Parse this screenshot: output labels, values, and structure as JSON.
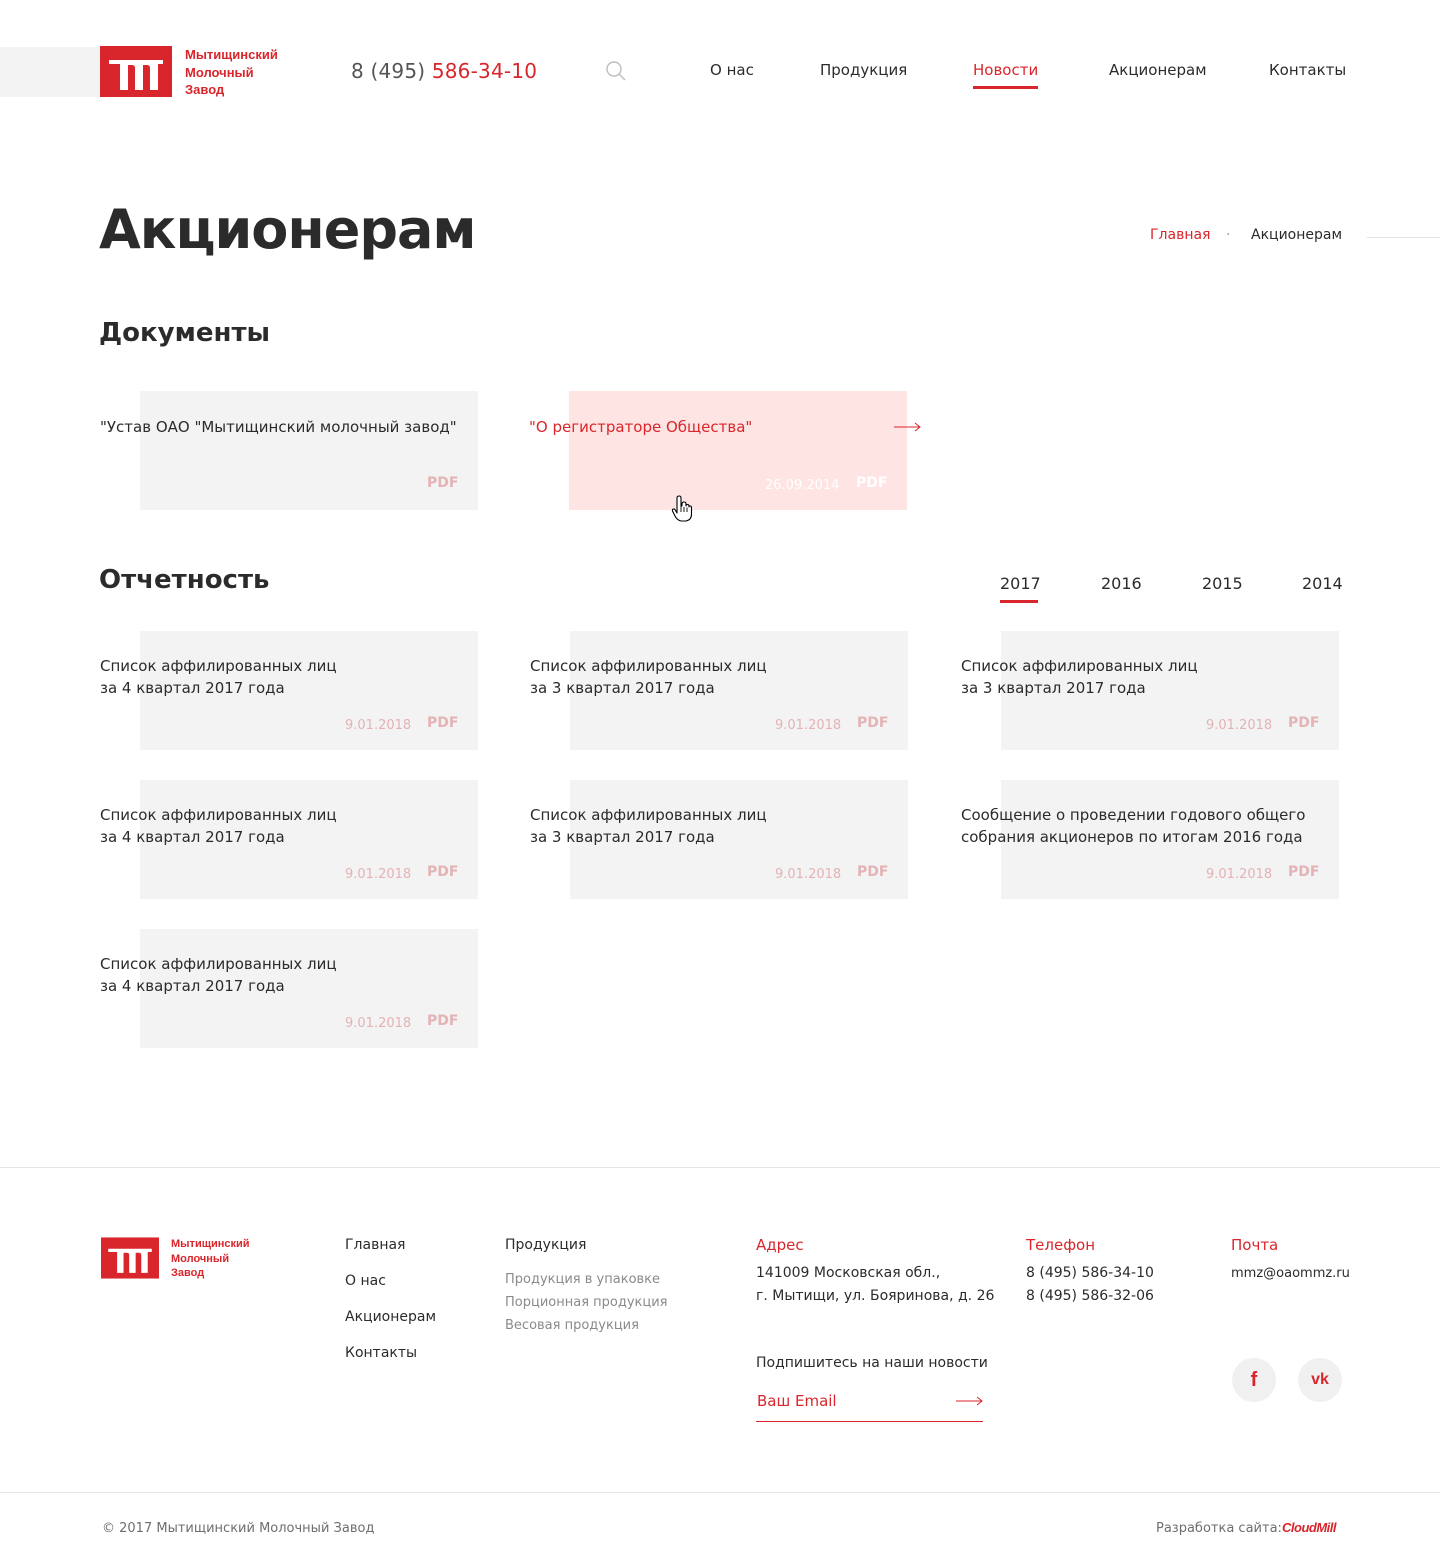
{
  "header": {
    "logo_lines": [
      "Мытищинский",
      "Молочный",
      "Завод"
    ],
    "phone_prefix": "8 (495)",
    "phone_number": "586-34-10",
    "nav": [
      {
        "label": "О нас"
      },
      {
        "label": "Продукция"
      },
      {
        "label": "Новости",
        "active": true
      },
      {
        "label": "Акционерам"
      },
      {
        "label": "Контакты"
      }
    ]
  },
  "page": {
    "title": "Акционерам",
    "breadcrumb": {
      "home": "Главная",
      "separator": "·",
      "current": "Акционерам"
    }
  },
  "documents": {
    "title": "Документы",
    "items": [
      {
        "title": "\"Устав ОАО \"Мытищинский молочный завод\"",
        "date": "",
        "format": "PDF"
      },
      {
        "title": "\"О регистраторе Общества\"",
        "date": "26.09.2014",
        "format": "PDF",
        "highlighted": true
      }
    ]
  },
  "reports": {
    "title": "Отчетность",
    "years": [
      {
        "label": "2017",
        "active": true
      },
      {
        "label": "2016"
      },
      {
        "label": "2015"
      },
      {
        "label": "2014"
      }
    ],
    "items": [
      {
        "title_lines": [
          "Список аффилированных лиц",
          "за 4 квартал 2017 года"
        ],
        "date": "9.01.2018",
        "format": "PDF"
      },
      {
        "title_lines": [
          "Список аффилированных лиц",
          "за 3 квартал 2017 года"
        ],
        "date": "9.01.2018",
        "format": "PDF"
      },
      {
        "title_lines": [
          "Список аффилированных лиц",
          "за 3 квартал 2017 года"
        ],
        "date": "9.01.2018",
        "format": "PDF"
      },
      {
        "title_lines": [
          "Список аффилированных лиц",
          "за 4 квартал 2017 года"
        ],
        "date": "9.01.2018",
        "format": "PDF"
      },
      {
        "title_lines": [
          "Список аффилированных лиц",
          "за 3 квартал 2017 года"
        ],
        "date": "9.01.2018",
        "format": "PDF"
      },
      {
        "title_lines": [
          "Сообщение о проведении годового общего",
          "собрания акционеров по итогам 2016 года"
        ],
        "date": "9.01.2018",
        "format": "PDF"
      },
      {
        "title_lines": [
          "Список аффилированных лиц",
          "за 4 квартал 2017 года"
        ],
        "date": "9.01.2018",
        "format": "PDF"
      }
    ]
  },
  "footer": {
    "logo_lines": [
      "Мытищинский",
      "Молочный",
      "Завод"
    ],
    "nav": [
      "Главная",
      "О нас",
      "Акционерам",
      "Контакты"
    ],
    "products": {
      "title": "Продукция",
      "items": [
        "Продукция в упаковке",
        "Порционная продукция",
        "Весовая продукция"
      ]
    },
    "address": {
      "title": "Адрес",
      "lines": [
        "141009 Московская обл.,",
        "г. Мытищи, ул. Бояринова, д. 26"
      ]
    },
    "phone": {
      "title": "Телефон",
      "lines": [
        "8 (495) 586-34-10",
        "8 (495) 586-32-06"
      ]
    },
    "mail": {
      "title": "Почта",
      "value": "mmz@oaommz.ru"
    },
    "subscribe": {
      "title": "Подпишитесь на наши новости",
      "placeholder": "Ваш Email"
    },
    "social": [
      {
        "name": "facebook",
        "glyph": "f"
      },
      {
        "name": "vk",
        "glyph": "vk"
      }
    ],
    "copyright": "© 2017 Мытищинский Молочный Завод",
    "developer_label": "Разработка сайта:",
    "developer_name": "CloudMill"
  },
  "colors": {
    "accent": "#d9262c",
    "card_bg": "#f3f3f3",
    "card_highlight": "#ffe4e4",
    "muted_label": "#e3b3b5"
  },
  "icons": [
    "logo-mark",
    "search-icon",
    "arrow-right-icon",
    "hand-cursor-icon",
    "facebook-icon",
    "vk-icon"
  ]
}
